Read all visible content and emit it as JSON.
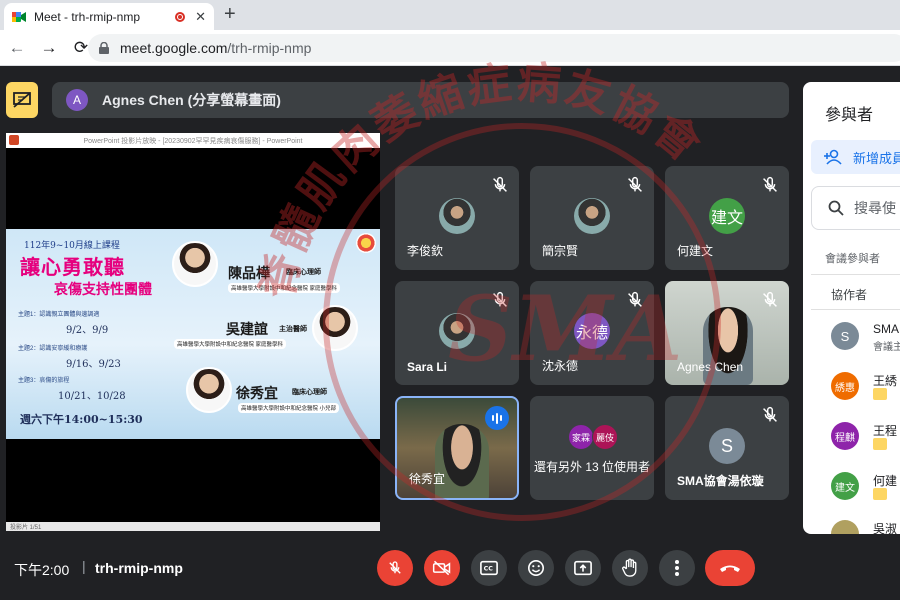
{
  "browser": {
    "tab_title": "Meet - trh-rmip-nmp",
    "new_tab_icon": "plus-icon",
    "url_host": "meet.google.com",
    "url_path": "/trh-rmip-nmp"
  },
  "presenter": {
    "avatar_letter": "A",
    "name": "Agnes Chen (分享螢幕畫面)"
  },
  "slide": {
    "window_title": "PowerPoint 投影片放映 - [20230902罕罕見疾病哀傷服務] - PowerPoint",
    "date_line": "112年9~10月線上課程",
    "title_line1": "讓心勇敢聽",
    "title_line2": "哀傷支持性團體",
    "topics": [
      {
        "label": "主題1：認識親立團體與邊調適",
        "dates": "9/2、9/9"
      },
      {
        "label": "主題2：認識安寧緩和療護",
        "dates": "9/16、9/23"
      },
      {
        "label": "主題3：哀傷的旅程",
        "dates": "10/21、10/28"
      }
    ],
    "time_line": "週六下午14:00~15:30",
    "speakers": [
      {
        "name": "陳品樺",
        "role": "臨床心理師",
        "org": "高雄醫學大學附設中和紀念醫院 家庭醫學科"
      },
      {
        "name": "吳建誼",
        "role": "主治醫師",
        "org": "高雄醫學大學附設中和紀念醫院 家庭醫學科"
      },
      {
        "name": "徐秀宜",
        "role": "臨床心理師",
        "org": "高雄醫學大學附設中和紀念醫院 小兒部"
      }
    ],
    "status_text": "投影片 1/51"
  },
  "tiles": [
    {
      "name": "李俊欽",
      "avatar_type": "photo",
      "muted": true
    },
    {
      "name": "簡宗賢",
      "avatar_type": "photo",
      "muted": true
    },
    {
      "name": "何建文",
      "avatar_text": "建文",
      "avatar_color": "#43a047",
      "muted": true
    },
    {
      "name": "Sara Li",
      "avatar_type": "photo",
      "muted": true
    },
    {
      "name": "沈永德",
      "avatar_text": "永德",
      "avatar_color": "#7e57c2",
      "muted": true
    },
    {
      "name": "Agnes Chen",
      "avatar_type": "video",
      "muted": true
    },
    {
      "name": "徐秀宜",
      "avatar_type": "video",
      "speaking": true
    },
    {
      "more_label": "還有另外 13 位使用者",
      "avatars": [
        "家霖",
        "麗伎"
      ]
    },
    {
      "name": "SMA協會湯依璇",
      "avatar_text": "S",
      "avatar_color": "#7b8a97",
      "muted": true
    }
  ],
  "watermark": {
    "text": "脊髓肌肉萎縮症病友協會",
    "initials": "SMA",
    "color": "#c62828"
  },
  "panel": {
    "title": "參與者",
    "add_label": "新增成員",
    "search_placeholder": "搜尋使",
    "section_label": "會議參與者",
    "collab_header": "協作者",
    "participants": [
      {
        "avatar": "S",
        "color": "#7b8a97",
        "name": "SMA",
        "sub": "會議主"
      },
      {
        "avatar": "綉惠",
        "color": "#ef6c00",
        "name": "王綉"
      },
      {
        "avatar": "程麒",
        "color": "#8e24aa",
        "name": "王程"
      },
      {
        "avatar": "建文",
        "color": "#43a047",
        "name": "何建"
      },
      {
        "name": "吳淑"
      }
    ]
  },
  "bottom": {
    "time": "下午2:00",
    "separator": "|",
    "meeting_code": "trh-rmip-nmp"
  },
  "colors": {
    "background": "#202124",
    "tile": "#3c4043",
    "danger": "#ea4335",
    "accent": "#1a73e8",
    "present_yellow": "#fdd663"
  }
}
